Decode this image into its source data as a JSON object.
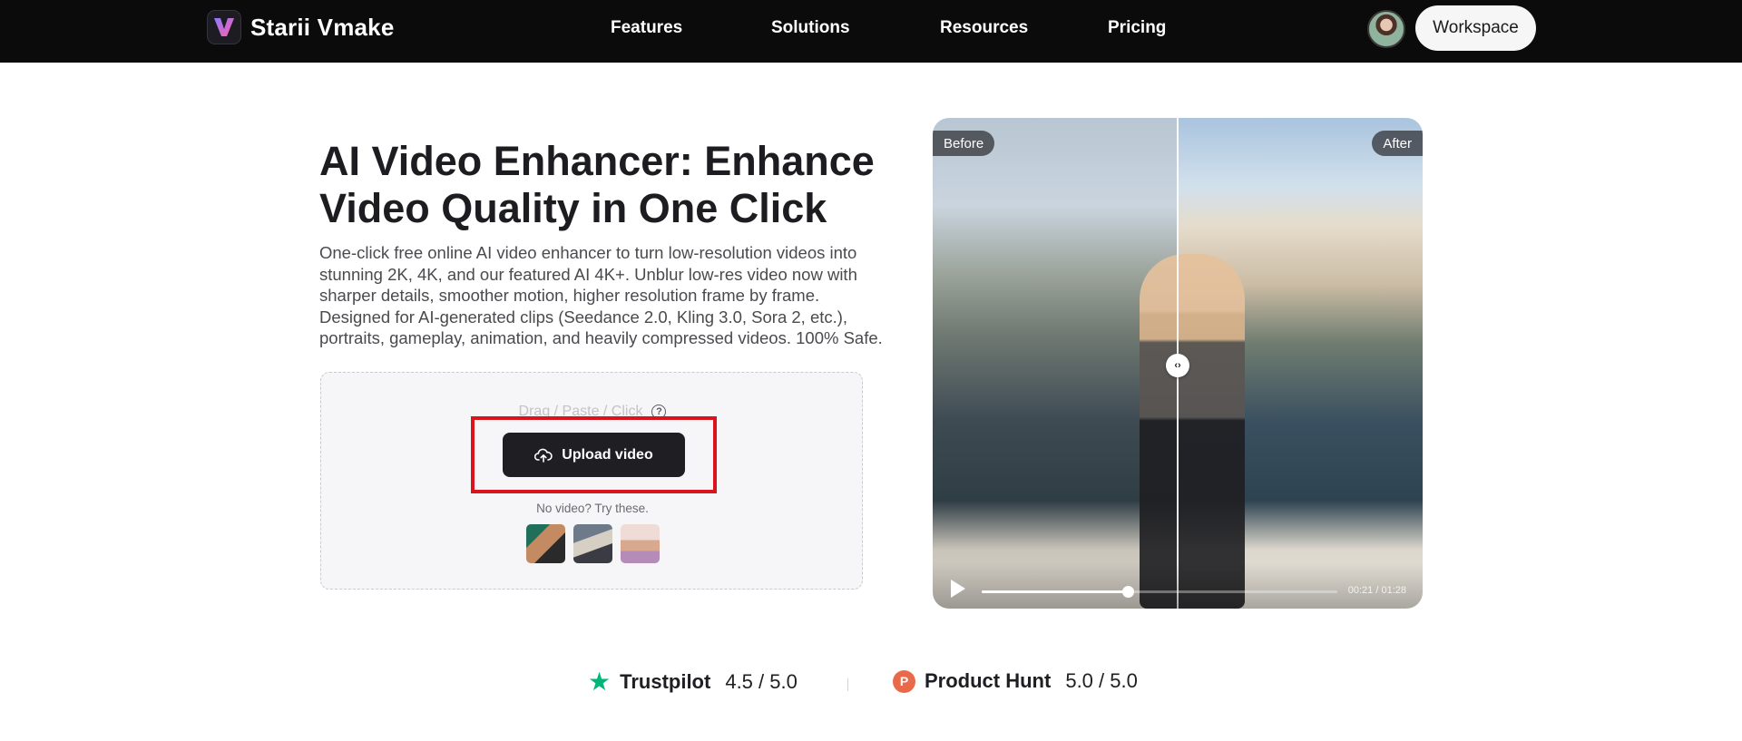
{
  "nav": {
    "brand": "Starii Vmake",
    "links": [
      "Features",
      "Solutions",
      "Resources",
      "Pricing"
    ],
    "workspace_label": "Workspace"
  },
  "hero": {
    "title": "AI Video Enhancer: Enhance Video Quality in One Click",
    "description": "One-click free online AI video enhancer to turn low-resolution videos into stunning 2K, 4K, and our featured AI 4K+. Unblur low-res video now with sharper details, smoother motion, higher resolution frame by frame. Designed for AI-generated clips (Seedance 2.0, Kling 3.0, Sora 2, etc.), portraits, gameplay, animation, and heavily compressed videos. 100% Safe."
  },
  "upload": {
    "hint": "Drag / Paste / Click",
    "button_label": "Upload video",
    "try_text": "No video? Try these.",
    "samples": [
      "sample-1",
      "sample-2",
      "sample-3"
    ]
  },
  "preview": {
    "before_label": "Before",
    "after_label": "After",
    "time": "00:21 / 01:28",
    "progress": 0.41,
    "split": 0.5
  },
  "ratings": {
    "trustpilot": {
      "name": "Trustpilot",
      "score": "4.5 / 5.0"
    },
    "producthunt": {
      "name": "Product Hunt",
      "score": "5.0 / 5.0",
      "icon_letter": "P"
    }
  },
  "colors": {
    "accent_dark": "#1f1f23",
    "highlight_red": "#d9141c",
    "trustpilot_green": "#00b67a",
    "producthunt_orange": "#e96a4b"
  }
}
